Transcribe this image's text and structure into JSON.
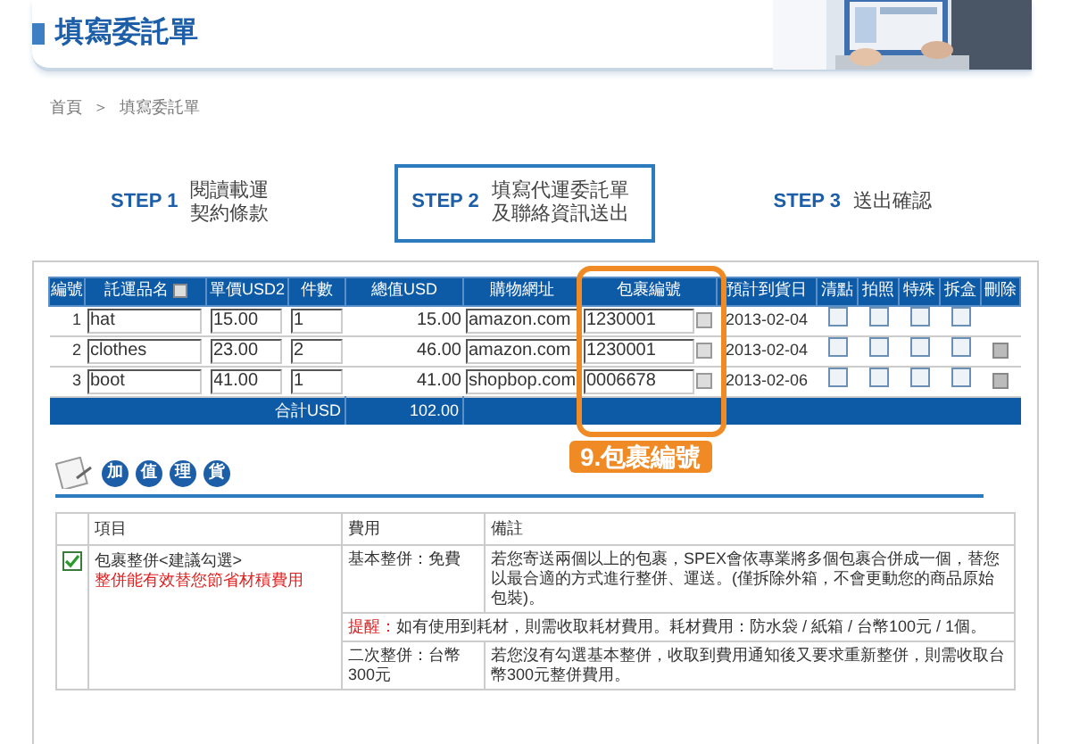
{
  "header": {
    "title": "填寫委託單"
  },
  "breadcrumb": [
    "首頁",
    "＞",
    "填寫委託單"
  ],
  "steps": [
    {
      "label": "STEP 1",
      "text": "閱讀載運契約條款",
      "selected": false
    },
    {
      "label": "STEP 2",
      "text": "填寫代運委託單及聯絡資訊送出",
      "selected": true
    },
    {
      "label": "STEP 3",
      "text": "送出確認",
      "selected": false
    }
  ],
  "order_table": {
    "columns": [
      "編號",
      "託運品名",
      "單價USD2",
      "件數",
      "總值USD",
      "購物網址",
      "包裹編號",
      "預計到貨日",
      "清點",
      "拍照",
      "特殊",
      "拆盒",
      "刪除"
    ],
    "rows": [
      {
        "no": "1",
        "name": "hat",
        "price": "15.00",
        "qty": "1",
        "total": "15.00",
        "url": "amazon.com",
        "package": "1230001",
        "date": "2013-02-04",
        "checks": [
          {
            "checked": false
          },
          {
            "checked": false
          },
          {
            "checked": false
          },
          {
            "checked": false
          }
        ],
        "deletable": false
      },
      {
        "no": "2",
        "name": "clothes",
        "price": "23.00",
        "qty": "2",
        "total": "46.00",
        "url": "amazon.com",
        "package": "1230001",
        "date": "2013-02-04",
        "checks": [
          {
            "checked": false
          },
          {
            "checked": false
          },
          {
            "checked": false
          },
          {
            "checked": false
          }
        ],
        "deletable": true
      },
      {
        "no": "3",
        "name": "boot",
        "price": "41.00",
        "qty": "1",
        "total": "41.00",
        "url": "shopbop.com",
        "package": "0006678",
        "date": "2013-02-06",
        "checks": [
          {
            "checked": false
          },
          {
            "checked": false
          },
          {
            "checked": false
          },
          {
            "checked": false
          }
        ],
        "deletable": true
      }
    ],
    "sum_label": "合計USD",
    "sum_value": "102.00"
  },
  "callout": "9.包裹編號",
  "value_added": {
    "heading_chars": [
      "加",
      "值",
      "理",
      "貨"
    ],
    "columns": [
      "項目",
      "費用",
      "備註"
    ],
    "item": {
      "checked": true,
      "title": "包裹整併<建議勾選>",
      "subtitle": "整併能有效替您節省材積費用"
    },
    "fees": [
      {
        "kind": "fee",
        "fee": "基本整併：免費",
        "note": "若您寄送兩個以上的包裹，SPEX會依專業將多個包裹合併成一個，替您以最合適的方式進行整併、運送。(僅拆除外箱，不會更動您的商品原始包裝)。"
      },
      {
        "kind": "reminder",
        "label": "提醒：",
        "text": "如有使用到耗材，則需收取耗材費用。耗材費用：防水袋 / 紙箱 / 台幣100元 / 1個。"
      },
      {
        "kind": "fee",
        "fee": "二次整併：台幣300元",
        "note": "若您沒有勾選基本整併，收取到費用通知後又要求重新整併，則需收取台幣300元整併費用。"
      }
    ]
  }
}
